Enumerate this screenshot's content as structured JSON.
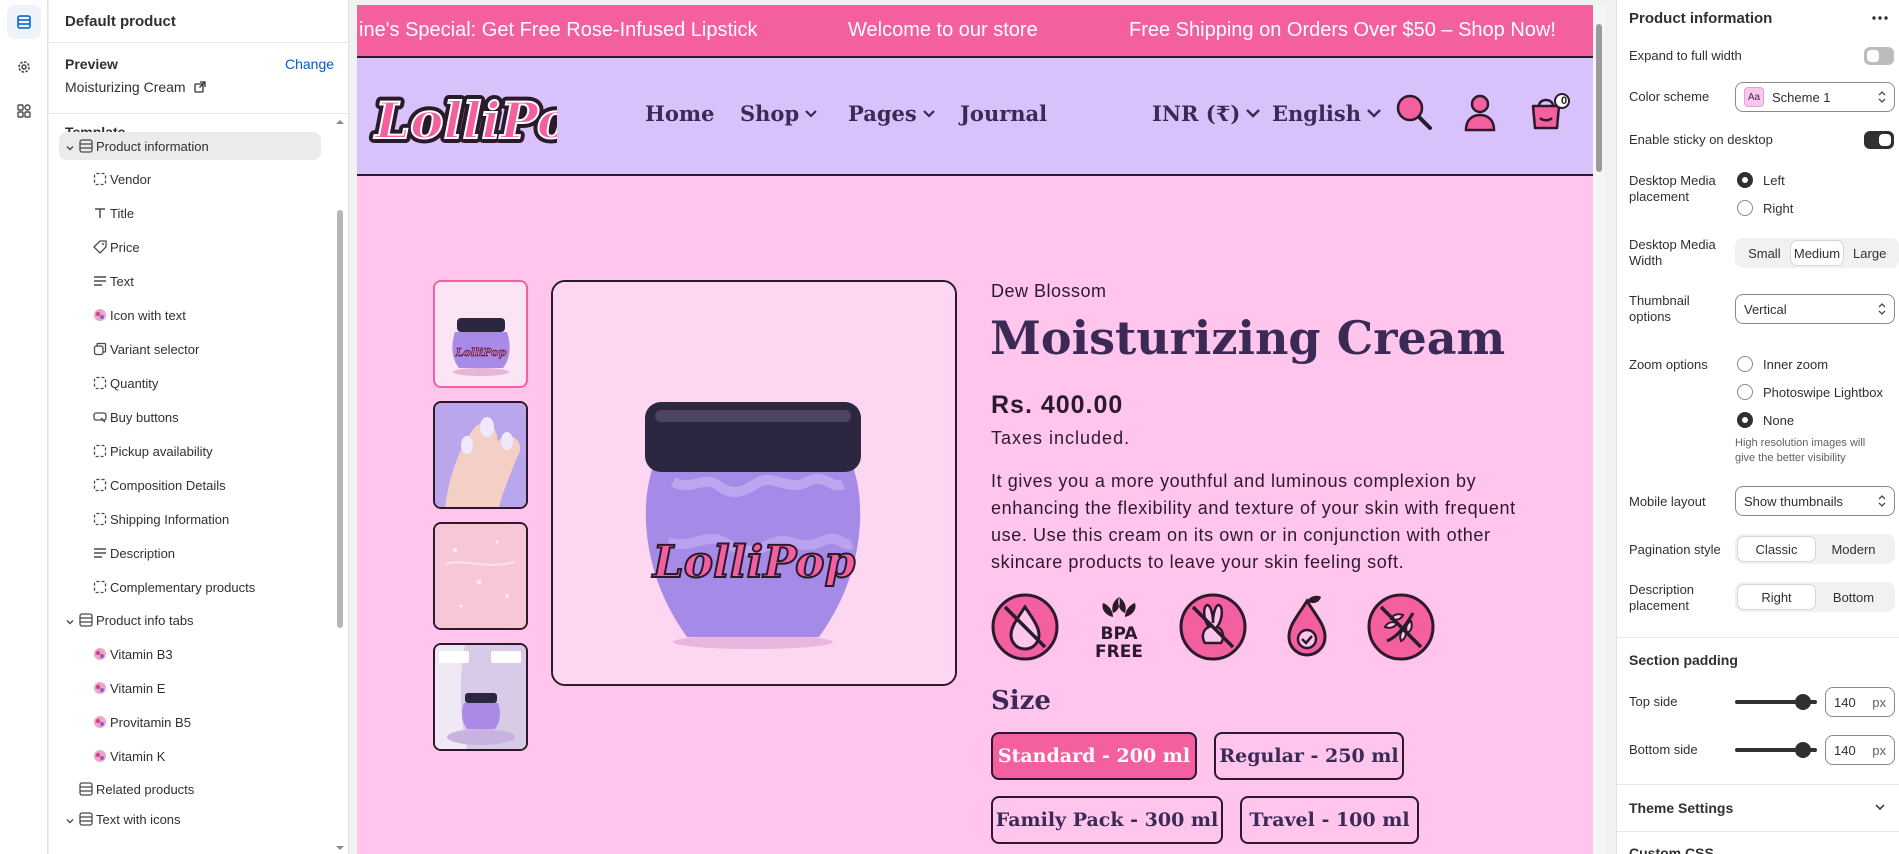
{
  "left_panel": {
    "title": "Default product",
    "preview_label": "Preview",
    "change_label": "Change",
    "preview_value": "Moisturizing Cream",
    "template_label": "Template",
    "tree": [
      {
        "label": "Product information",
        "icon": "section-icon",
        "selected": true
      },
      {
        "label": "Vendor",
        "icon": "block-icon"
      },
      {
        "label": "Title",
        "icon": "text-t-icon"
      },
      {
        "label": "Price",
        "icon": "price-tag-icon"
      },
      {
        "label": "Text",
        "icon": "text-lines-icon"
      },
      {
        "label": "Icon with text",
        "icon": "image-thumbnail-icon"
      },
      {
        "label": "Variant selector",
        "icon": "variant-icon"
      },
      {
        "label": "Quantity",
        "icon": "block-icon"
      },
      {
        "label": "Buy buttons",
        "icon": "buy-button-icon"
      },
      {
        "label": "Pickup availability",
        "icon": "block-icon"
      },
      {
        "label": "Composition Details",
        "icon": "block-icon"
      },
      {
        "label": "Shipping Information",
        "icon": "block-icon"
      },
      {
        "label": "Description",
        "icon": "text-lines-icon"
      },
      {
        "label": "Complementary products",
        "icon": "block-icon"
      },
      {
        "label": "Product info tabs",
        "icon": "section-icon"
      },
      {
        "label": "Vitamin B3",
        "icon": "image-thumbnail-icon"
      },
      {
        "label": "Vitamin E",
        "icon": "image-thumbnail-icon"
      },
      {
        "label": "Provitamin B5",
        "icon": "image-thumbnail-icon"
      },
      {
        "label": "Vitamin K",
        "icon": "image-thumbnail-icon"
      },
      {
        "label": "Related products",
        "icon": "section-icon"
      },
      {
        "label": "Text with icons",
        "icon": "section-icon"
      }
    ]
  },
  "store": {
    "announcement": [
      "ine's Special: Get Free Rose-Infused Lipstick",
      "Welcome to our store",
      "Free Shipping on Orders Over $50 – Shop Now!"
    ],
    "logo_text": "LolliPop",
    "nav": [
      "Home",
      "Shop",
      "Pages",
      "Journal"
    ],
    "currency": "INR (₹)",
    "language": "English",
    "cart_count": "0",
    "jar_label": "LolliPop",
    "product": {
      "vendor": "Dew Blossom",
      "title": "Moisturizing Cream",
      "price": "Rs. 400.00",
      "tax_note": "Taxes included.",
      "description": "It gives you a more youthful and luminous complexion by enhancing the flexibility and texture of your skin with frequent use. Use this cream on its own or in conjunction with other skincare products to leave your skin feeling soft.",
      "badge_bpa_line1": "BPA",
      "badge_bpa_line2": "FREE",
      "size_heading": "Size",
      "sizes": [
        "Standard - 200 ml",
        "Regular - 250 ml",
        "Family Pack - 300 ml",
        "Travel - 100 ml"
      ],
      "selected_size": "Standard - 200 ml"
    }
  },
  "right_panel": {
    "title": "Product information",
    "expand_label": "Expand to full width",
    "color_scheme_label": "Color scheme",
    "color_scheme_value": "Scheme 1",
    "color_scheme_swatch": "Aa",
    "sticky_label": "Enable sticky on desktop",
    "media_placement_label": "Desktop Media placement",
    "media_placement_options": [
      "Left",
      "Right"
    ],
    "media_width_label": "Desktop Media Width",
    "media_width_options": [
      "Small",
      "Medium",
      "Large"
    ],
    "thumbnail_label": "Thumbnail options",
    "thumbnail_value": "Vertical",
    "zoom_label": "Zoom options",
    "zoom_options": [
      "Inner zoom",
      "Photoswipe Lightbox",
      "None"
    ],
    "zoom_hint": "High resolution images will give the better visibility",
    "mobile_layout_label": "Mobile layout",
    "mobile_layout_value": "Show thumbnails",
    "pagination_label": "Pagination style",
    "pagination_options": [
      "Classic",
      "Modern"
    ],
    "desc_placement_label": "Description placement",
    "desc_placement_options": [
      "Right",
      "Bottom"
    ],
    "section_padding_label": "Section padding",
    "top_side_label": "Top side",
    "top_side_value": "140",
    "bottom_side_label": "Bottom side",
    "bottom_side_value": "140",
    "unit": "px",
    "theme_settings_label": "Theme Settings",
    "cut_off_label": "Custom CSS"
  },
  "colors": {
    "accent": "#f45fa0",
    "header_bg": "#d9c2fb",
    "page_bg": "#ffc5ec",
    "heading": "#3b2a55"
  }
}
